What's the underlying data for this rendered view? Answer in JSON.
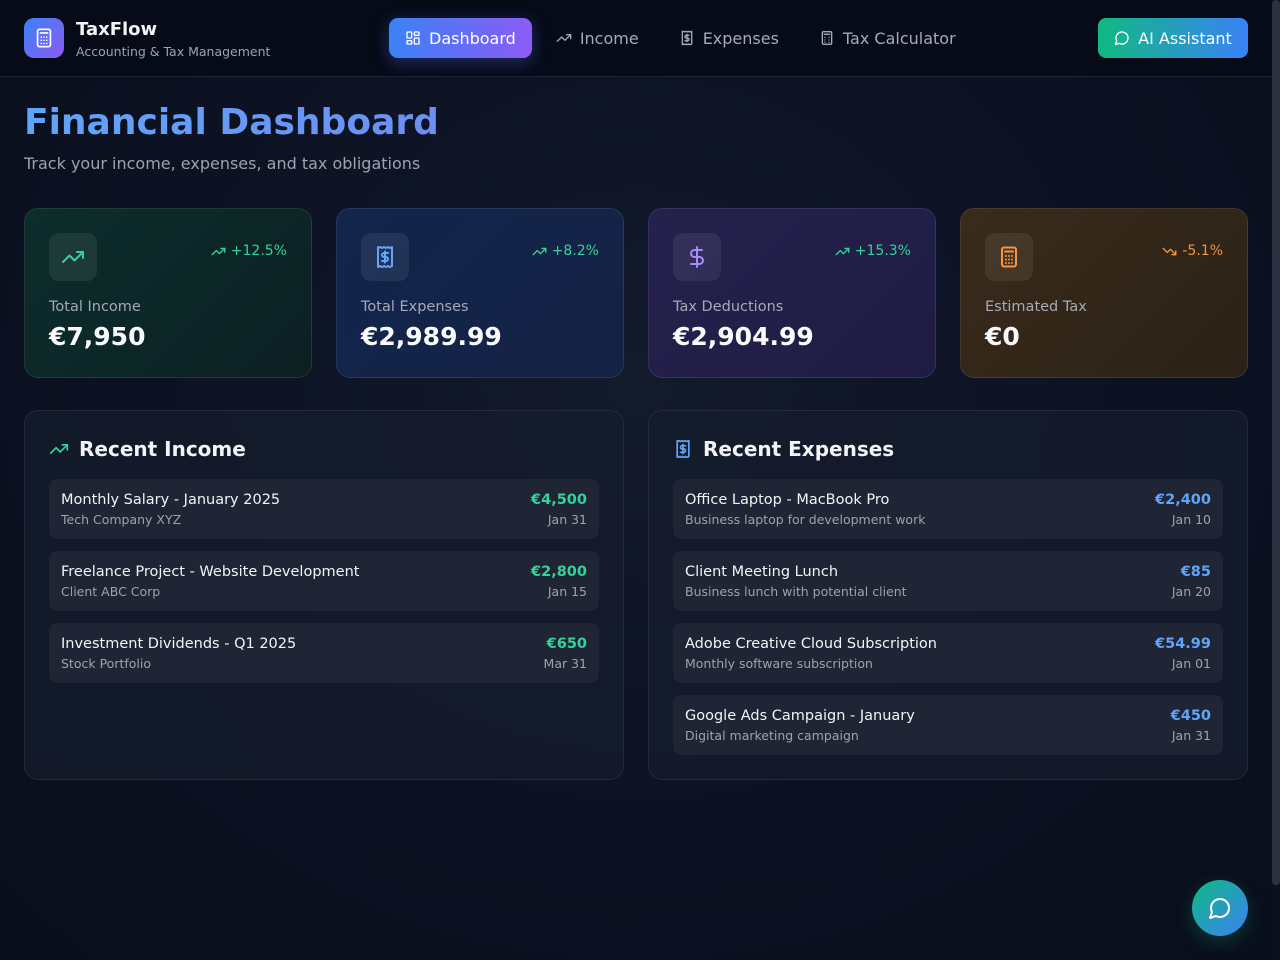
{
  "app": {
    "name": "TaxFlow",
    "subtitle": "Accounting & Tax Management",
    "logo_icon": "calculator-icon"
  },
  "nav": {
    "items": [
      {
        "label": "Dashboard",
        "icon": "dashboard-icon",
        "active": true
      },
      {
        "label": "Income",
        "icon": "trending-up-icon",
        "active": false
      },
      {
        "label": "Expenses",
        "icon": "receipt-icon",
        "active": false
      },
      {
        "label": "Tax Calculator",
        "icon": "calculator-icon",
        "active": false
      }
    ],
    "ai_button": {
      "label": "AI Assistant",
      "icon": "chat-icon"
    }
  },
  "page": {
    "title": "Financial Dashboard",
    "subtitle": "Track your income, expenses, and tax obligations"
  },
  "stats": [
    {
      "label": "Total Income",
      "value": "€7,950",
      "trend": "+12.5%",
      "trend_dir": "up",
      "icon": "trending-up-icon",
      "accent": "#34d399"
    },
    {
      "label": "Total Expenses",
      "value": "€2,989.99",
      "trend": "+8.2%",
      "trend_dir": "up",
      "icon": "receipt-icon",
      "accent": "#60a5fa"
    },
    {
      "label": "Tax Deductions",
      "value": "€2,904.99",
      "trend": "+15.3%",
      "trend_dir": "up",
      "icon": "dollar-icon",
      "accent": "#a78bfa"
    },
    {
      "label": "Estimated Tax",
      "value": "€0",
      "trend": "-5.1%",
      "trend_dir": "down",
      "icon": "calculator-icon",
      "accent": "#fb923c"
    }
  ],
  "recent_income": {
    "title": "Recent Income",
    "icon": "trending-up-icon",
    "items": [
      {
        "title": "Monthly Salary - January 2025",
        "source": "Tech Company XYZ",
        "amount": "€4,500",
        "date": "Jan 31"
      },
      {
        "title": "Freelance Project - Website Development",
        "source": "Client ABC Corp",
        "amount": "€2,800",
        "date": "Jan 15"
      },
      {
        "title": "Investment Dividends - Q1 2025",
        "source": "Stock Portfolio",
        "amount": "€650",
        "date": "Mar 31"
      }
    ]
  },
  "recent_expenses": {
    "title": "Recent Expenses",
    "icon": "receipt-icon",
    "items": [
      {
        "title": "Office Laptop - MacBook Pro",
        "description": "Business laptop for development work",
        "amount": "€2,400",
        "date": "Jan 10"
      },
      {
        "title": "Client Meeting Lunch",
        "description": "Business lunch with potential client",
        "amount": "€85",
        "date": "Jan 20"
      },
      {
        "title": "Adobe Creative Cloud Subscription",
        "description": "Monthly software subscription",
        "amount": "€54.99",
        "date": "Jan 01"
      },
      {
        "title": "Google Ads Campaign - January",
        "description": "Digital marketing campaign",
        "amount": "€450",
        "date": "Jan 31"
      }
    ]
  },
  "colors": {
    "income_accent": "#34d399",
    "expense_accent": "#60a5fa",
    "brand_gradient_start": "#3b82f6",
    "brand_gradient_end": "#8b5cf6"
  }
}
